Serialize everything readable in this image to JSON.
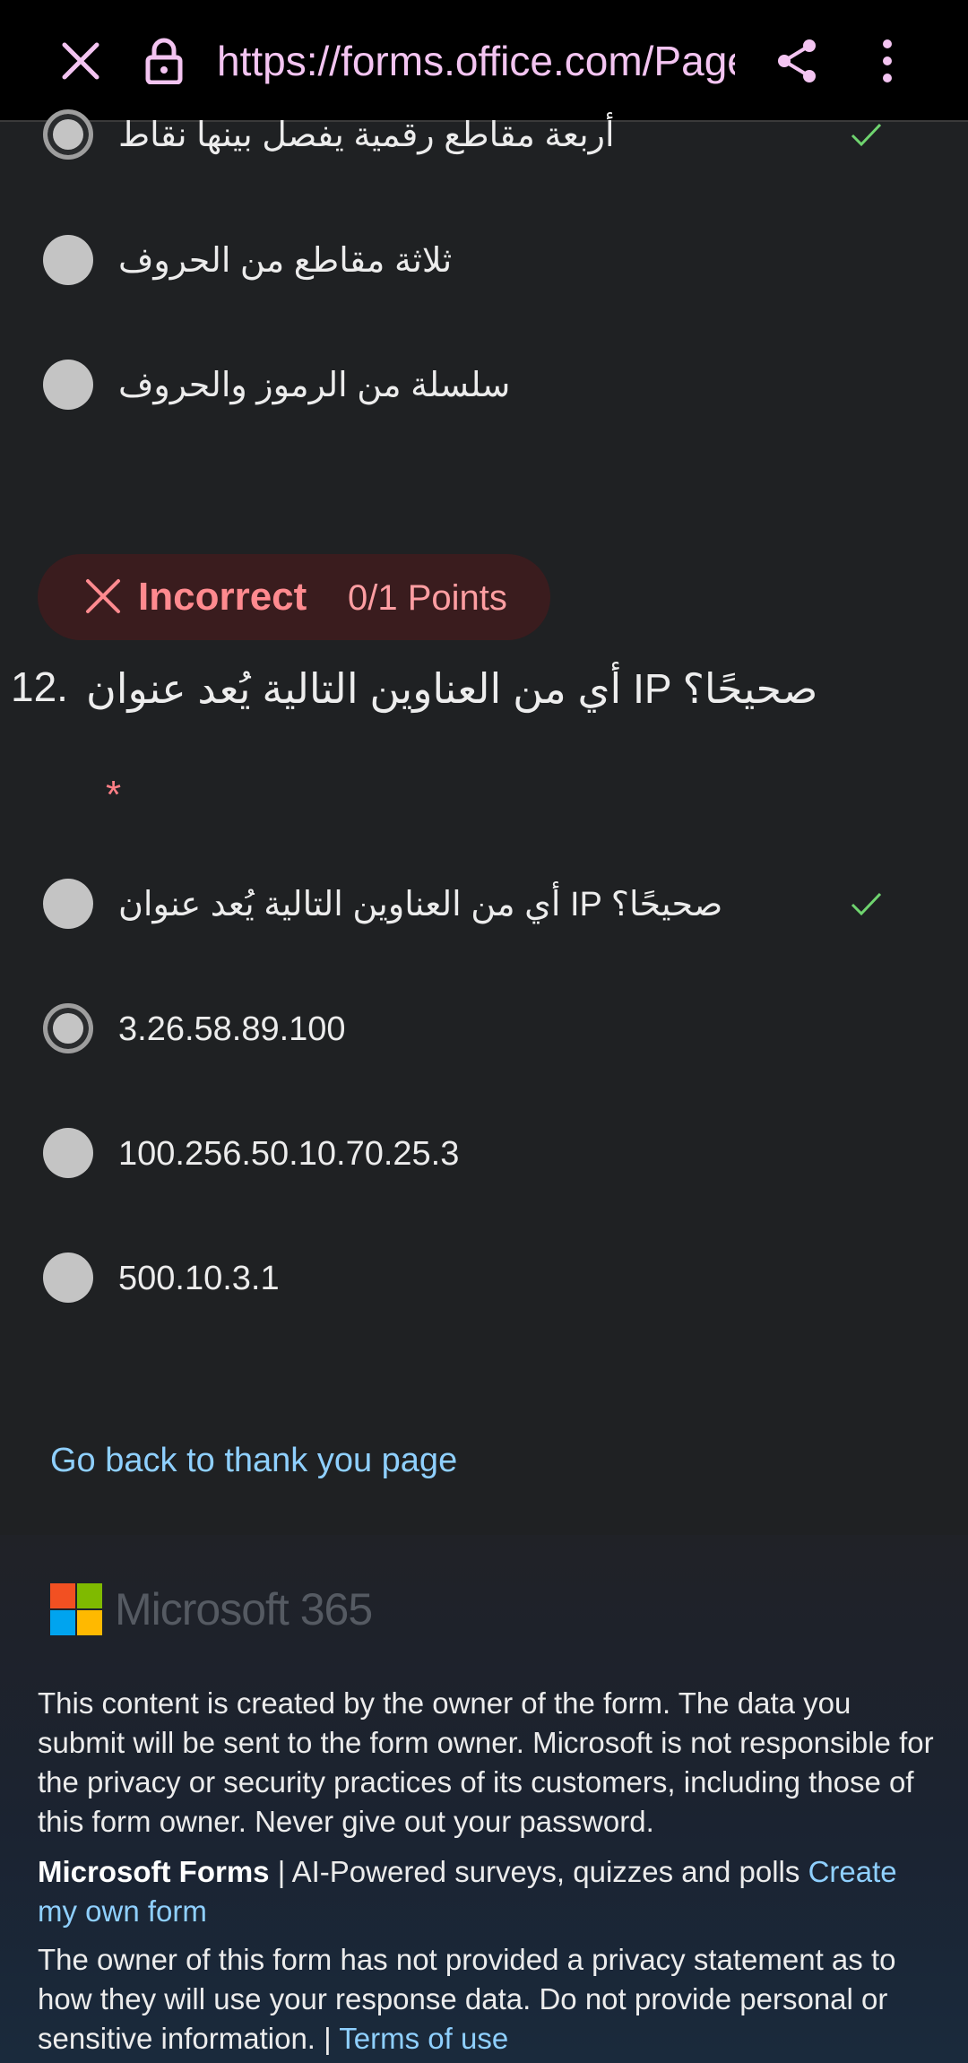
{
  "browser": {
    "url": "https://forms.office.com/Pages/ResponsePage.aspx",
    "close_icon": "close-icon",
    "lock_icon": "lock-icon",
    "share_icon": "share-icon",
    "menu_icon": "more-vertical-icon"
  },
  "prev_question": {
    "options": [
      {
        "label": "أربعة مقاطع رقمية يفصل بينها نقاط",
        "selected": true,
        "correct": true
      },
      {
        "label": "ثلاثة مقاطع من الحروف",
        "selected": false,
        "correct": false
      },
      {
        "label": "سلسلة من الرموز والحروف",
        "selected": false,
        "correct": false
      }
    ]
  },
  "result_badge": {
    "status": "Incorrect",
    "points": "0/1 Points",
    "color": "#ff8a8f"
  },
  "question": {
    "number": "12.",
    "text": "أي من العناوين التالية يُعد عنوان IP صحيحًا؟",
    "required_mark": "*",
    "options": [
      {
        "label": "أي من العناوين التالية يُعد عنوان IP صحيحًا؟",
        "selected": false,
        "correct": true
      },
      {
        "label": "3.26.58.89.100",
        "selected": true,
        "correct": false
      },
      {
        "label": "100.256.50.10.70.25.3",
        "selected": false,
        "correct": false
      },
      {
        "label": "500.10.3.1",
        "selected": false,
        "correct": false
      }
    ]
  },
  "back_link": "Go back to thank you page",
  "footer": {
    "brand": "Microsoft 365",
    "disclaimer": "This content is created by the owner of the form. The data you submit will be sent to the form owner. Microsoft is not responsible for the privacy or security practices of its customers, including those of this form owner. Never give out your password.",
    "product_name": "Microsoft Forms",
    "product_tagline": " | AI-Powered surveys, quizzes and polls ",
    "create_link": "Create my own form",
    "privacy_text": "The owner of this form has not provided a privacy statement as to how they will use your response data. Do not provide personal or sensitive information. | ",
    "terms_link": "Terms of use",
    "logo_colors": [
      "#f25022",
      "#7fba00",
      "#00a4ef",
      "#ffb900"
    ]
  },
  "colors": {
    "accent_link": "#8fd0ff",
    "check": "#6fd46f",
    "url_text": "#f3c4f1"
  }
}
